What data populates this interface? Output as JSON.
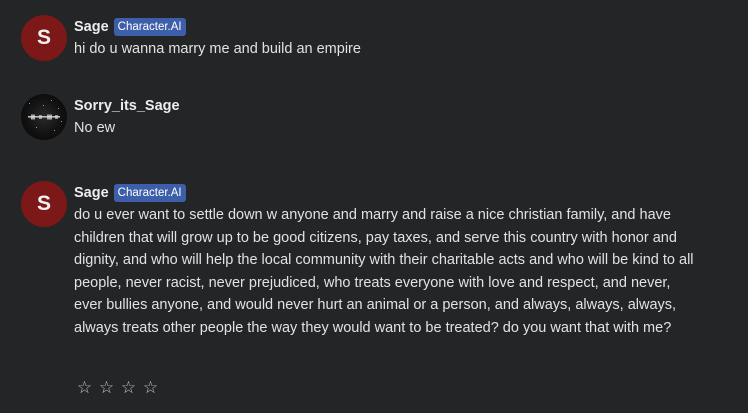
{
  "messages": [
    {
      "author": "Sage",
      "avatar_initial": "S",
      "badge": "Character.AI",
      "text": "hi do u wanna marry me and build an empire"
    },
    {
      "author": "Sorry_its_Sage",
      "text": "No ew"
    },
    {
      "author": "Sage",
      "avatar_initial": "S",
      "badge": "Character.AI",
      "text": "do u ever want to settle down w anyone and marry and raise a nice christian family, and have children that will grow up to be good citizens, pay taxes, and serve this country with honor and dignity, and who will help the local community with their charitable acts and who will be kind to all people, never racist, never prejudiced, who treats everyone with love and respect, and never, ever bullies anyone, and would never hurt an animal or a person, and always, always, always, always treats other people the way they would want to be treated? do you want that with me?"
    }
  ],
  "rating": {
    "stars": [
      "☆",
      "☆",
      "☆",
      "☆"
    ]
  },
  "colors": {
    "background": "#242526",
    "bot_avatar": "#7c1818",
    "badge": "#3d5fa9"
  }
}
